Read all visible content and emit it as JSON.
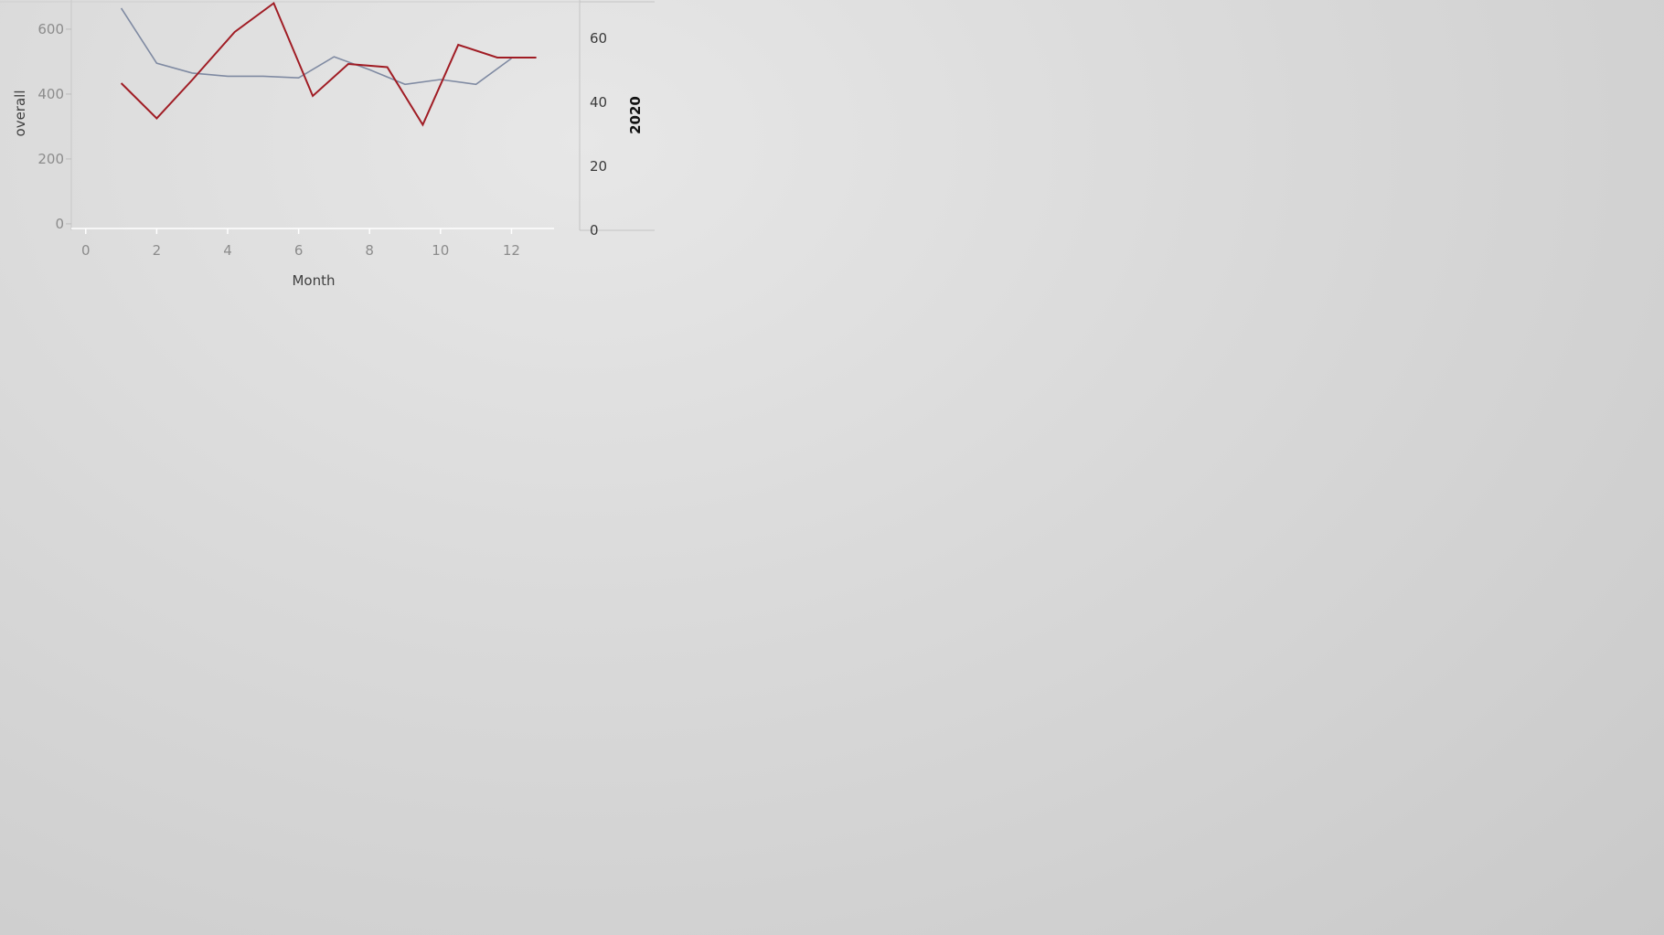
{
  "chart_data": {
    "type": "line",
    "xlabel": "Month",
    "ylabel_left": "overall",
    "ylabel_right": "2020",
    "x_ticks": [
      0,
      2,
      4,
      6,
      8,
      10,
      12
    ],
    "left_ticks": [
      0,
      200,
      400,
      600
    ],
    "right_ticks": [
      0,
      20,
      40,
      60
    ],
    "xlim": [
      -0.2,
      13.2
    ],
    "ylim_left": [
      -20,
      690
    ],
    "ylim_right": [
      0,
      72
    ],
    "grid": false,
    "series": [
      {
        "axis": "left",
        "color": "#7f8aa2",
        "x": [
          1,
          2,
          3,
          4,
          5,
          6,
          7,
          8,
          9,
          10,
          11,
          12
        ],
        "values": [
          665,
          495,
          465,
          455,
          455,
          450,
          515,
          475,
          430,
          445,
          430,
          510
        ]
      },
      {
        "axis": "right",
        "color": "#a01c24",
        "x": [
          1,
          2,
          3,
          4.2,
          5.3,
          6.4,
          7.4,
          8.5,
          9.5,
          10.5,
          11.6,
          12.7
        ],
        "values": [
          46,
          35,
          47,
          62,
          71,
          42,
          52,
          51,
          33,
          58,
          54,
          54
        ]
      }
    ]
  }
}
